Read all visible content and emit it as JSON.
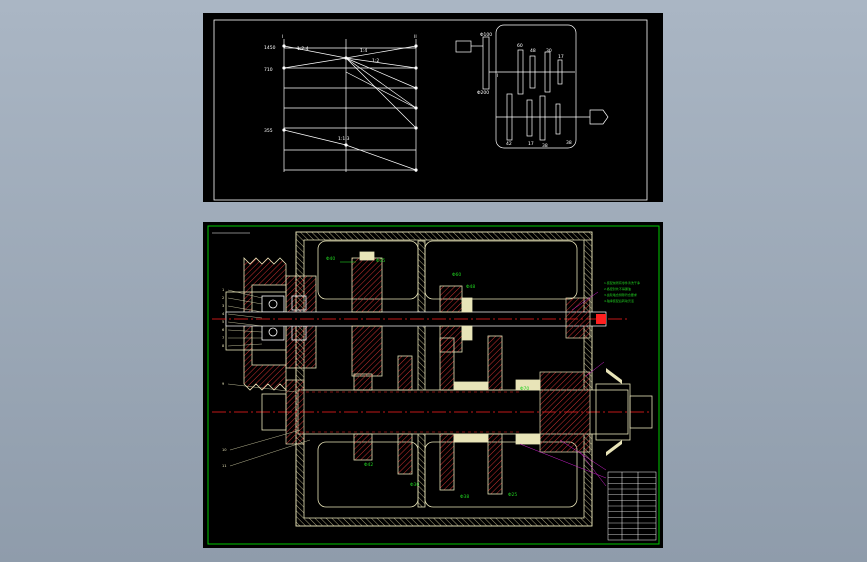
{
  "colors": {
    "background": "#9aa7b5",
    "sheet": "#000000",
    "line": "#ffffff",
    "border": "#00c800",
    "gear": "#e8e4b8",
    "hatch": "#c83030",
    "center_line": "#ff2020",
    "dimension": "#20d020",
    "leader": "#d020d0"
  },
  "speed_diagram": {
    "shaft_labels": [
      "I",
      "II"
    ],
    "speed_labels": [
      "1450",
      "710",
      "355"
    ],
    "ratio_labels": [
      "1:2.4",
      "1:4",
      "1:2",
      "1:1.3"
    ]
  },
  "gear_diagram": {
    "pulley_label": "Φ100",
    "pulley_label2": "Φ200",
    "shaft_label": "I",
    "tooth_labels_top": [
      "60",
      "48",
      "30",
      "17"
    ],
    "tooth_labels_bottom": [
      "42",
      "17",
      "38",
      "38"
    ]
  },
  "assembly": {
    "callouts": [
      "Φ40",
      "Φ35",
      "Φ60",
      "Φ48",
      "Φ42",
      "Φ30",
      "Φ38",
      "Φ25",
      "Φ70"
    ],
    "leaders_left": [
      "1",
      "2",
      "3",
      "4",
      "5",
      "6",
      "7",
      "8",
      "9",
      "10",
      "11",
      "12"
    ],
    "notes": [
      "1.装配前所有零件清洗干净",
      "2.各密封处不得漏油",
      "3.齿轮啮合侧隙符合要求",
      "4.轴承装配后转动灵活"
    ],
    "title_block_rows": 12
  }
}
